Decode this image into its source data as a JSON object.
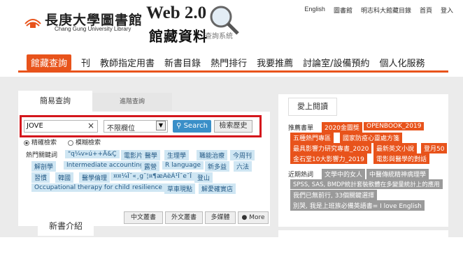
{
  "header": {
    "logo_title": "長庚大學圖書館",
    "logo_subtitle": "Chang Gung University Library",
    "web2_title": "Web 2.0",
    "web2_subtitle": "館藏資料",
    "web2_caption": "查詢系統",
    "links": [
      "English",
      "圖書館",
      "明志科大館藏目錄",
      "首頁",
      "登入"
    ]
  },
  "nav": {
    "items": [
      "館藏查詢",
      "刊",
      "教師指定用書",
      "新書目錄",
      "熱門排行",
      "我要推薦",
      "討論室/設備預約",
      "個人化服務"
    ]
  },
  "search": {
    "tab_simple": "簡易查詢",
    "tab_advanced": "進階查詢",
    "input_value": "JOVE",
    "clear": "×",
    "field_select": "不限欄位",
    "search_button": "Search",
    "history_button": "檢索歷史",
    "radio_exact": "精確檢索",
    "radio_fuzzy": "模糊檢索",
    "hot_label": "熱門關鍵詞",
    "hot_tags": [
      "\"q¼v»ú++Ä&Ç",
      "電影片 醫學",
      "生理學",
      "職能治療",
      "今周刊",
      "解剖學",
      "Intermediate accounting",
      "露營",
      "R language",
      "新多益",
      "六法",
      "習慣",
      "韓國",
      "醫學倫理",
      "¤¤¼Ï¯«¸g¯¦¤¶æAèÁ¹Ï¯e¯Ï",
      "登山",
      "Occupational therapy for children",
      "resilience",
      "草車現點",
      "解愛確實店"
    ],
    "lang_buttons": [
      "中文叢書",
      "外文叢書",
      "多媒體",
      "More"
    ]
  },
  "newbook": {
    "title": "新書介紹"
  },
  "reading": {
    "title": "愛上閱讀",
    "recommend_label": "推薦書單",
    "recommend_tags": [
      "2020金圖獎",
      "OPENBOOK_2019",
      "五種熱門專區",
      "國家防疫心靈處方箋",
      "最具影響力研究專書_2020",
      "最新英文小說",
      "登月50",
      "金石堂10大影響力_2019",
      "電影與醫學的對話"
    ],
    "recent_label": "近期熱詞",
    "recent_tags": [
      "文學中的女人",
      "中醫傳統精神病理學",
      "SPSS, SAS, BMDP統計套裝軟體在多變量統計上的應用",
      "我們已無前行, 33個關鍵選擇",
      "別哭, 我是上班族必備英語書= I love English"
    ]
  }
}
